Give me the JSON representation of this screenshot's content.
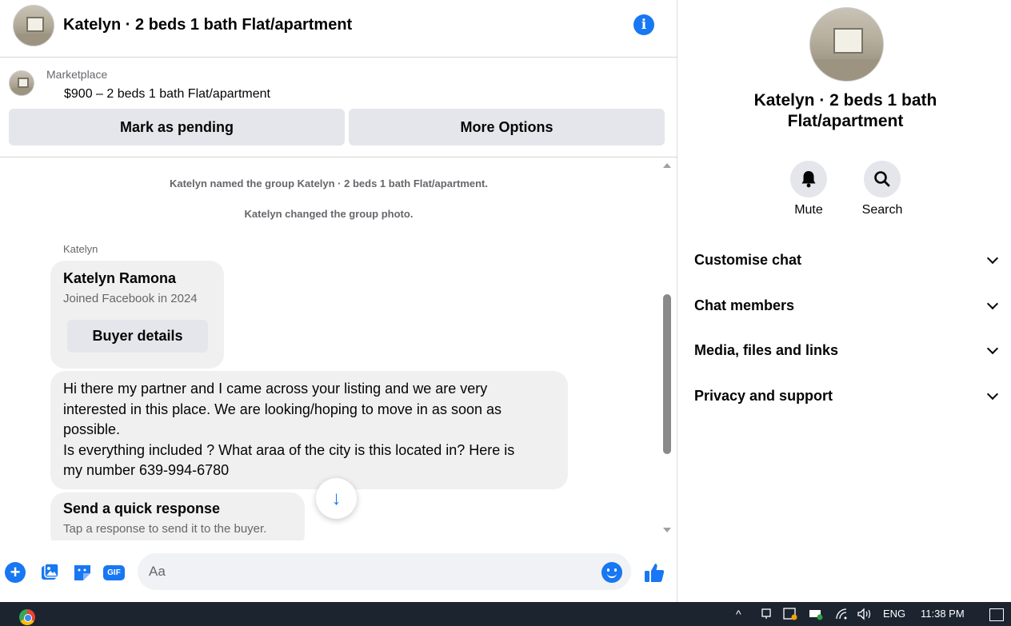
{
  "header": {
    "title": "Katelyn · 2 beds 1 bath Flat/apartment",
    "info_icon": "i"
  },
  "listing": {
    "source": "Marketplace",
    "price_title": "$900 – 2 beds 1 bath Flat/apartment",
    "mark_pending_label": "Mark as pending",
    "more_options_label": "More Options"
  },
  "messages": {
    "system": [
      "Katelyn named the group Katelyn · 2 beds 1 bath Flat/apartment.",
      "Katelyn changed the group photo."
    ],
    "sender_name": "Katelyn",
    "buyer_card": {
      "name": "Katelyn Ramona",
      "joined": "Joined Facebook in 2024",
      "button_label": "Buyer details"
    },
    "bubble_lines": [
      "Hi there my partner and I came across your listing and we are very",
      "interested in this place. We are looking/hoping to move in as soon as",
      "possible.",
      "Is everything included ? What araa of the city is this located in? Here is",
      "my number 639-994-6780"
    ],
    "quick_response": {
      "title": "Send a quick response",
      "subtitle": "Tap a response to send it to the buyer."
    },
    "scroll_down_glyph": "↓"
  },
  "composer": {
    "plus_glyph": "+",
    "gif_label": "GIF",
    "input_placeholder": "Aa"
  },
  "sidebar": {
    "title": "Katelyn · 2 beds 1 bath Flat/apartment",
    "actions": [
      {
        "label": "Mute",
        "icon": "bell-icon"
      },
      {
        "label": "Search",
        "icon": "search-icon"
      }
    ],
    "items": [
      {
        "label": "Customise chat"
      },
      {
        "label": "Chat members"
      },
      {
        "label": "Media, files and links"
      },
      {
        "label": "Privacy and support"
      }
    ]
  },
  "taskbar": {
    "chevron": "^",
    "icons": [
      "meet-now-icon",
      "cloud-icon",
      "network-icon",
      "wifi-icon",
      "volume-icon"
    ],
    "language": "ENG",
    "time": "11:38 PM"
  },
  "colors": {
    "accent": "#1877f2",
    "bubble": "#f0f0f0",
    "button": "#e4e6eb",
    "secondary_text": "#65676b",
    "taskbar": "#1c2430"
  }
}
